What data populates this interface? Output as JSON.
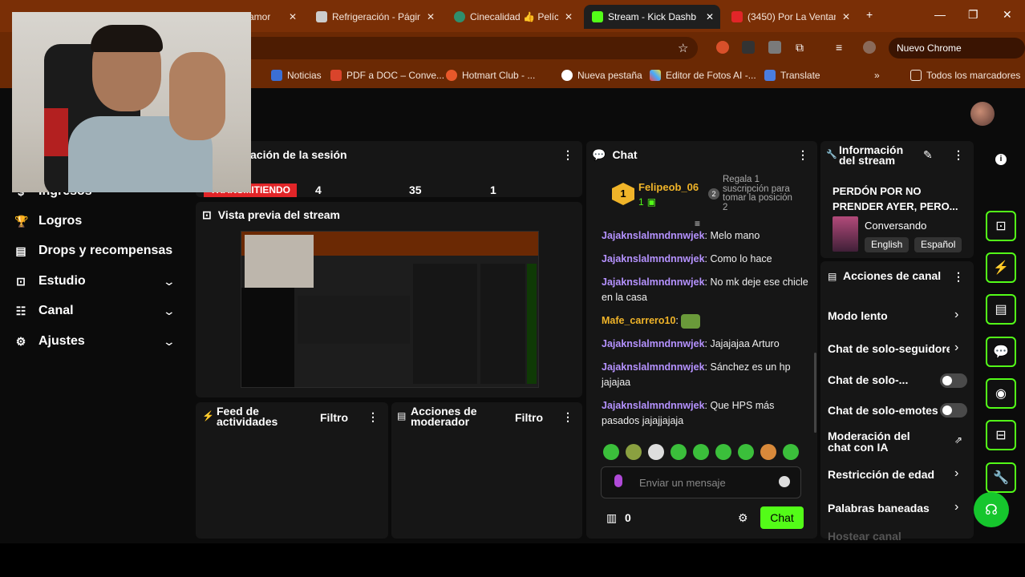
{
  "browser": {
    "tabs": [
      {
        "title": "amor"
      },
      {
        "title": "Refrigeración - Págin"
      },
      {
        "title": "Cinecalidad 👍 Pelíc"
      },
      {
        "title": "Stream - Kick Dashbo",
        "active": true
      },
      {
        "title": "(3450) Por La Ventan"
      }
    ],
    "chrome_update": "Nuevo Chrome disponible",
    "bookmarks": [
      "Noticias",
      "PDF a DOC – Conve...",
      "Hotmart Club - ...",
      "Nueva pestaña",
      "Editor de Fotos AI -...",
      "Translate"
    ],
    "all_bookmarks": "Todos los marcadores"
  },
  "sidebar": {
    "items": [
      {
        "label": "Ingresos",
        "icon": "money-icon"
      },
      {
        "label": "Logros",
        "icon": "trophy-icon"
      },
      {
        "label": "Drops y recompensas",
        "icon": "gift-icon"
      },
      {
        "label": "Estudio",
        "icon": "studio-icon",
        "expandable": true
      },
      {
        "label": "Canal",
        "icon": "channel-icon",
        "expandable": true
      },
      {
        "label": "Ajustes",
        "icon": "gear-icon",
        "expandable": true
      }
    ]
  },
  "session": {
    "title": "ación de la sesión",
    "status": "TRANSMITIENDO",
    "stats": [
      "4",
      "35",
      "1"
    ]
  },
  "preview": {
    "title": "Vista previa del stream"
  },
  "activity_feed": {
    "title": "Feed de actividades",
    "filter": "Filtro"
  },
  "mod_actions": {
    "title": "Acciones de moderador",
    "filter": "Filtro"
  },
  "chat": {
    "title": "Chat",
    "gift": {
      "user": "Felipeob_06",
      "count": "1",
      "text": "Regala 1 suscripción para tomar la posición 2"
    },
    "messages": [
      {
        "user": "Jajaknslalmndnnwjek",
        "text": "Melo mano"
      },
      {
        "user": "Jajaknslalmndnnwjek",
        "text": "Como lo hace"
      },
      {
        "user": "Jajaknslalmndnnwjek",
        "text": "No mk deje ese chicle en la casa"
      },
      {
        "user": "Mafe_carrero10",
        "text": "",
        "gold": true
      },
      {
        "user": "Jajaknslalmndnnwjek",
        "text": "Jajajajaa Arturo"
      },
      {
        "user": "Jajaknslalmndnnwjek",
        "text": "Sánchez es un hp jajajaa"
      },
      {
        "user": "Jajaknslalmndnnwjek",
        "text": "Que HPS más pasados jajajjajaja"
      }
    ],
    "input_placeholder": "Enviar un mensaje",
    "points": "0",
    "send_label": "Chat"
  },
  "stream_info": {
    "title": "Información del stream",
    "stream_title": "PERDÓN POR NO PRENDER AYER, PERO...",
    "category": "Conversando",
    "tags": [
      "English",
      "Español"
    ]
  },
  "channel_actions": {
    "title": "Acciones de canal",
    "items": [
      {
        "label": "Modo lento",
        "control": "chevron"
      },
      {
        "label": "Chat de solo-seguidores",
        "control": "chevron"
      },
      {
        "label": "Chat de solo-...",
        "control": "toggle"
      },
      {
        "label": "Chat de solo-emotes",
        "control": "toggle"
      },
      {
        "label": "Moderación del chat con IA",
        "control": "external"
      },
      {
        "label": "Restricción de edad",
        "control": "chevron"
      },
      {
        "label": "Palabras baneadas",
        "control": "chevron"
      },
      {
        "label": "Hostear canal",
        "control": "none"
      }
    ]
  },
  "colors": {
    "accent": "#53fc18",
    "live": "#e12528",
    "username": "#b592ff",
    "gold_user": "#f0b429"
  }
}
